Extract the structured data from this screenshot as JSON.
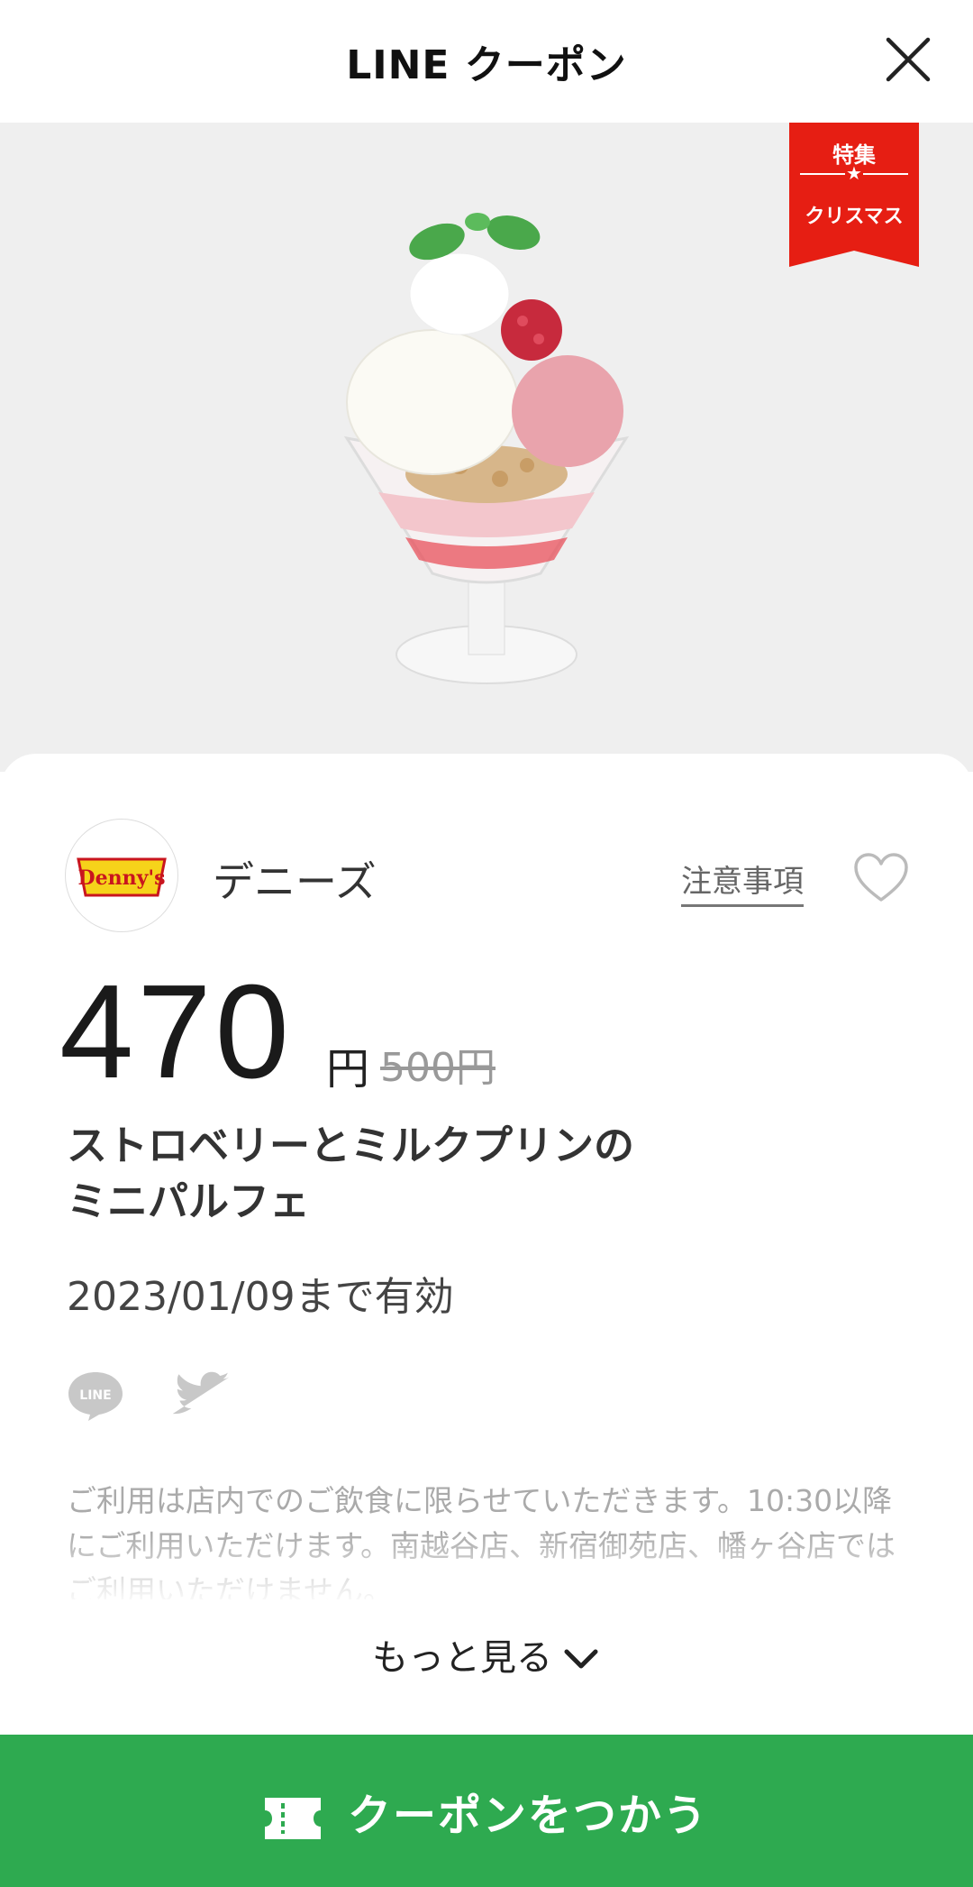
{
  "header": {
    "title": "LINE クーポン",
    "close_icon": "close-icon"
  },
  "hero": {
    "badge_line1": "特集",
    "badge_star": "★",
    "badge_line2": "クリスマス",
    "badge_color": "#e61e13",
    "background": "#efefef"
  },
  "store": {
    "name": "デニーズ",
    "logo_icon": "dennys-logo",
    "notice_label": "注意事項",
    "favorite_icon": "heart-icon"
  },
  "coupon": {
    "price": "470",
    "price_unit": "円",
    "original_price": "500円",
    "title_line1": "ストロベリーとミルクプリンの",
    "title_line2": "ミニパルフェ",
    "validity": "2023/01/09まで有効"
  },
  "share": {
    "line_icon": "line-share-icon",
    "twitter_icon": "twitter-icon"
  },
  "description": "ご利用は店内でのご飲食に限らせていただきます。10:30以降にご利用いただけます。南越谷店、新宿御苑店、幡ヶ谷店ではご利用いただけません。",
  "more_label": "もっと見る",
  "use_button": {
    "label": "クーポンをつかう",
    "color": "#2eaa50"
  }
}
